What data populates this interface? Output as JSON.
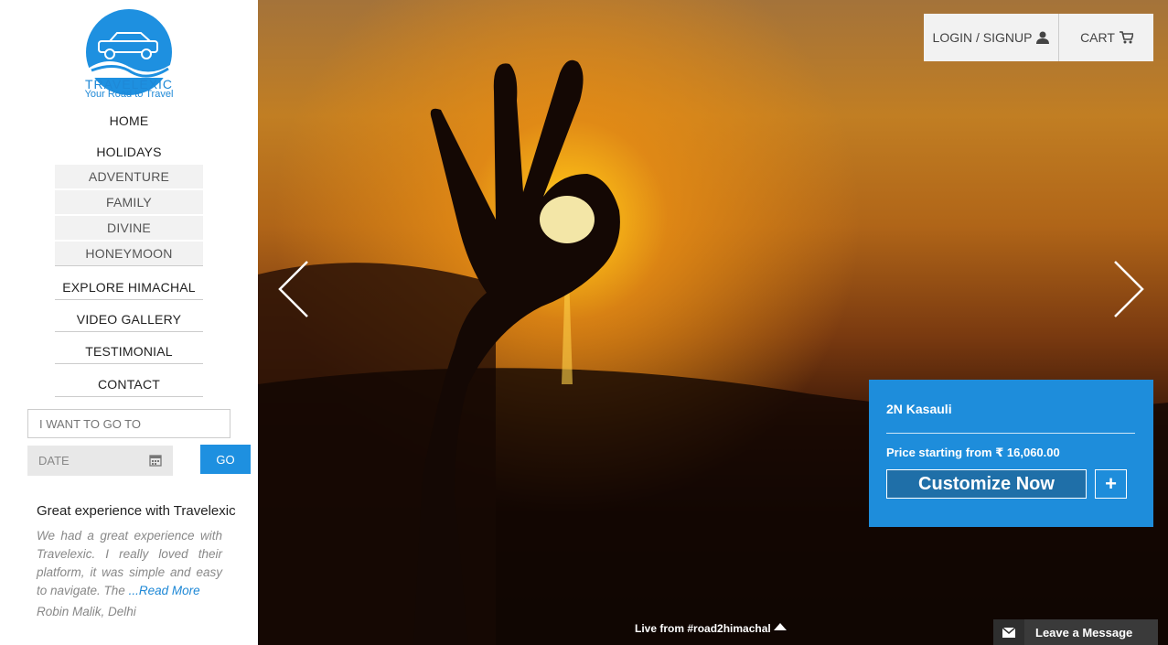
{
  "brand": {
    "name": "TRAVELEXIC",
    "tagline": "Your Road to Travel"
  },
  "nav": {
    "home": "HOME",
    "holidays": "HOLIDAYS",
    "holiday_items": [
      "ADVENTURE",
      "FAMILY",
      "DIVINE",
      "HONEYMOON"
    ],
    "explore": "EXPLORE HIMACHAL",
    "video": "VIDEO GALLERY",
    "testimonial": "TESTIMONIAL",
    "contact": "CONTACT"
  },
  "search": {
    "destination_placeholder": "I WANT TO GO TO",
    "date_placeholder": "DATE",
    "go_label": "GO"
  },
  "testimonial": {
    "title": "Great experience with Travelexic",
    "body": "We had a great experience with Travelexic. I really loved their platform, it was simple and easy to navigate. The ",
    "read_more": "...Read More",
    "author": "Robin Malik, Delhi"
  },
  "header": {
    "login_label": "LOGIN / SIGNUP",
    "cart_label": "CART"
  },
  "promo": {
    "title": "2N Kasauli",
    "price_prefix": "Price starting from",
    "currency_symbol": "₹",
    "price": "16,060.00",
    "customize_label": "Customize Now",
    "plus_label": "+"
  },
  "footer": {
    "live_label": "Live from #road2himachal",
    "leave_message_label": "Leave a Message"
  },
  "icons": {
    "user": "user-icon",
    "cart": "cart-icon",
    "calendar": "calendar-icon",
    "prev": "chevron-left-icon",
    "next": "chevron-right-icon",
    "envelope": "envelope-icon",
    "caret_up": "caret-up-icon"
  },
  "colors": {
    "accent": "#1e8ddb",
    "brand_blue": "#1e88d6"
  }
}
